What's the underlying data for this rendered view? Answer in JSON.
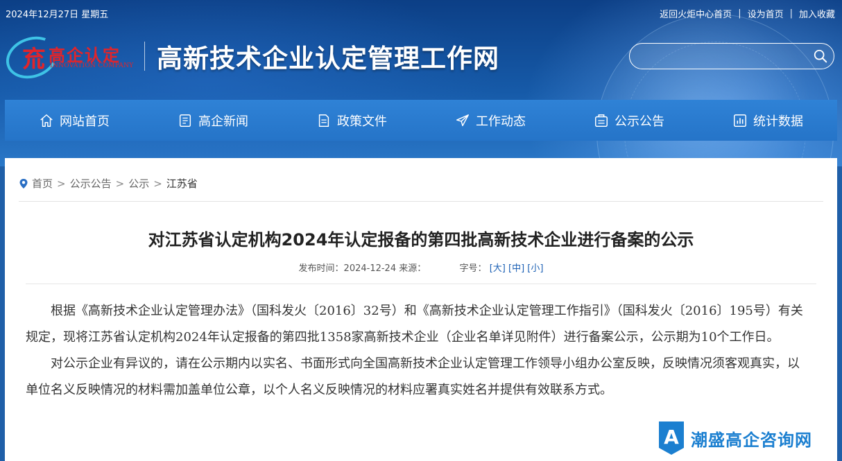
{
  "topbar": {
    "date": "2024年12月27日 星期五",
    "links": [
      "返回火炬中心首页",
      "设为首页",
      "加入收藏"
    ],
    "separator": "|"
  },
  "logo": {
    "cn": "高企认定",
    "en": "INNOVATION COMPANY",
    "glyph": "㐬"
  },
  "site_title": "高新技术企业认定管理工作网",
  "search": {
    "value": "",
    "placeholder": "",
    "icon": "search-icon"
  },
  "nav": [
    {
      "label": "网站首页",
      "icon": "home-icon"
    },
    {
      "label": "高企新闻",
      "icon": "document-icon"
    },
    {
      "label": "政策文件",
      "icon": "file-icon"
    },
    {
      "label": "工作动态",
      "icon": "send-icon"
    },
    {
      "label": "公示公告",
      "icon": "notice-icon"
    },
    {
      "label": "统计数据",
      "icon": "chart-icon"
    }
  ],
  "breadcrumb": {
    "items": [
      "首页",
      "公示公告",
      "公示"
    ],
    "current": "江苏省",
    "separator": ">"
  },
  "article": {
    "title": "对江苏省认定机构2024年认定报备的第四批高新技术企业进行备案的公示",
    "meta_date_label": "发布时间：",
    "meta_date": "2024-12-24",
    "meta_source_label": "来源：",
    "meta_size_label": "字号：",
    "font_sizes": [
      "[大]",
      "[中]",
      "[小]"
    ],
    "paragraphs": [
      "根据《高新技术企业认定管理办法》（国科发火〔2016〕32号）和《高新技术企业认定管理工作指引》（国科发火〔2016〕195号）有关规定，现将江苏省认定机构2024年认定报备的第四批1358家高新技术企业（企业名单详见附件）进行备案公示，公示期为10个工作日。",
      "对公示企业有异议的，请在公示期内以实名、书面形式向全国高新技术企业认定管理工作领导小组办公室反映，反映情况须客观真实，以单位名义反映情况的材料需加盖单位公章，以个人名义反映情况的材料应署真实姓名并提供有效联系方式。"
    ]
  },
  "watermark": {
    "text": "潮盛高企咨询网",
    "logo_letter": "A"
  },
  "colors": {
    "nav_bg": "#2a7bd0",
    "header_bg": "#165aa8",
    "logo_red": "#e2242a",
    "watermark": "#1b7fd0"
  }
}
